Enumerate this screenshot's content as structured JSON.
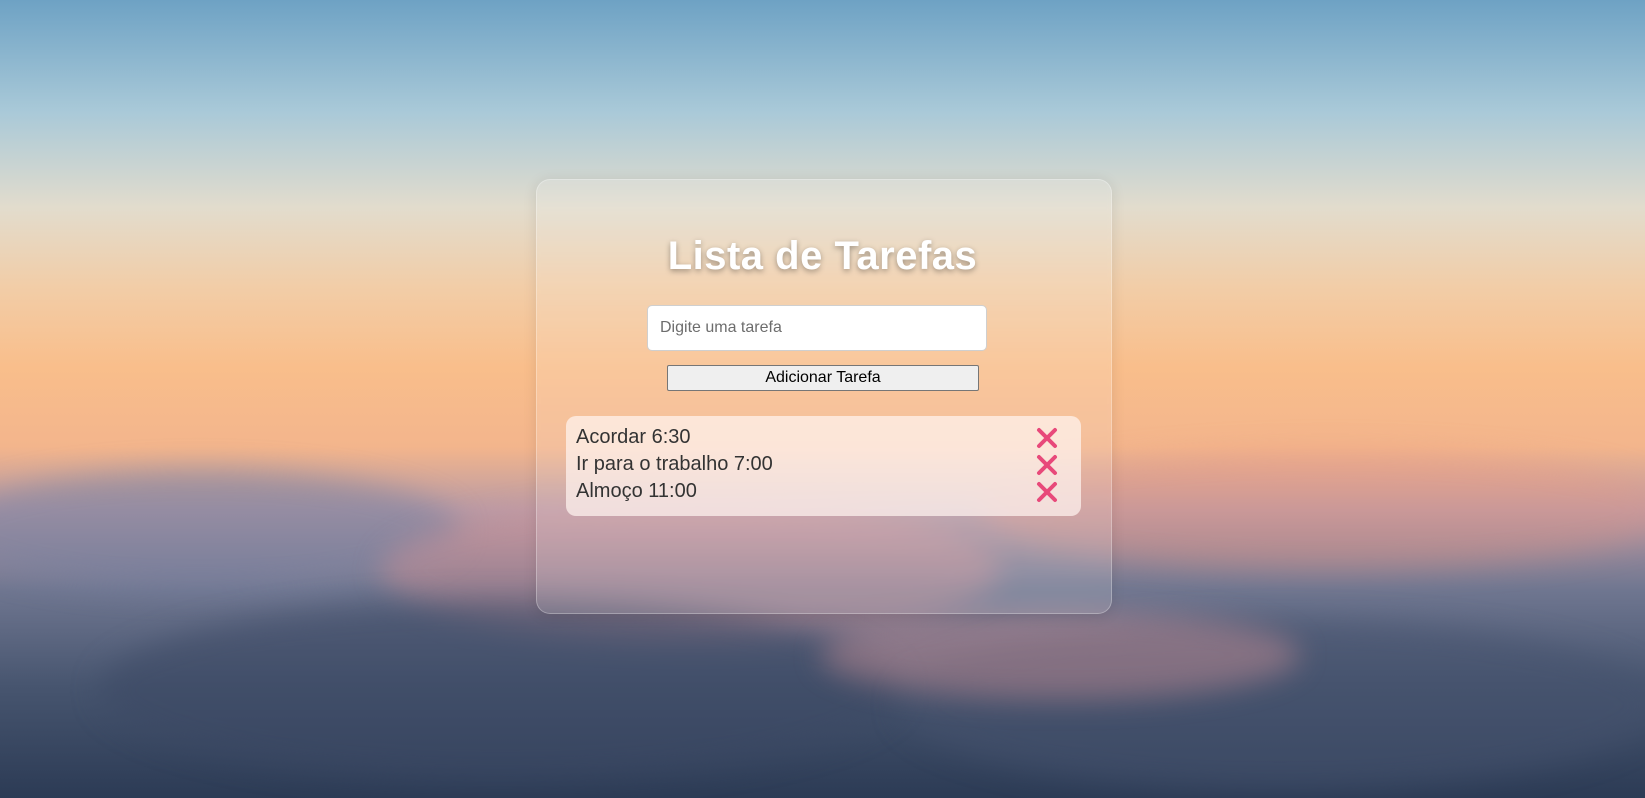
{
  "app": {
    "title": "Lista de Tarefas"
  },
  "form": {
    "input_value": "",
    "input_placeholder": "Digite uma tarefa",
    "add_button_label": "Adicionar Tarefa"
  },
  "tasks": [
    {
      "label": "Acordar 6:30",
      "remove_icon": "close-icon"
    },
    {
      "label": "Ir para o trabalho 7:00",
      "remove_icon": "close-icon"
    },
    {
      "label": "Almoço 11:00",
      "remove_icon": "close-icon"
    }
  ],
  "colors": {
    "remove_icon": "#e8497a",
    "title": "#ffffff",
    "list_background": "#fff4f0"
  }
}
